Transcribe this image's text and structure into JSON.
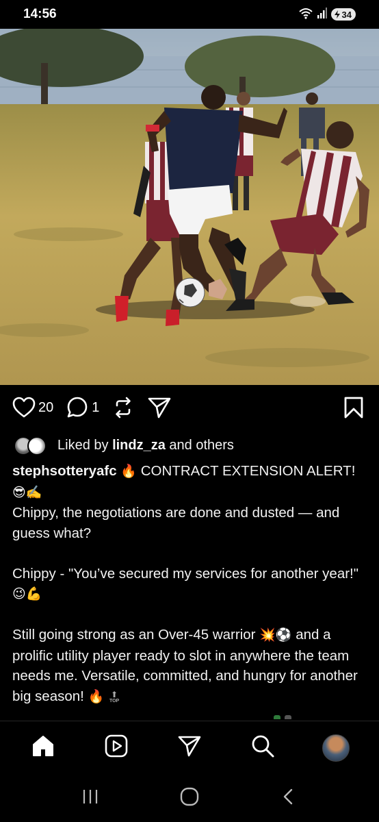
{
  "status_bar": {
    "time": "14:56",
    "battery": "34",
    "icons": [
      "wifi-icon",
      "signal-icon",
      "battery-icon"
    ]
  },
  "post": {
    "image": {
      "icon": "photo",
      "colors": {
        "grass": "#b9a25a",
        "sky": "#c7d4e0"
      }
    },
    "actions": {
      "likes": "20",
      "comments": "1",
      "icons": [
        "heart-icon",
        "comment-icon",
        "repost-icon",
        "share-icon",
        "bookmark-icon"
      ]
    },
    "liked_by": {
      "prefix": "Liked by",
      "user": "lindz_za",
      "suffix": "and others"
    },
    "caption": {
      "username": "stephsotteryafc",
      "line1_emoji": "🔥",
      "line1_text": "CONTRACT EXTENSION ALERT!",
      "line2_emoji": "😎✍️",
      "para1": "Chippy, the negotiations are done and dusted — and guess what?",
      "para2_text": "Chippy - \"You’ve secured my services for another year!\"",
      "para2_emoji": "😉💪",
      "para3_a": "Still going strong as an Over-45 warrior",
      "para3_emoji": "💥⚽",
      "para3_b": "and a prolific utility player ready to slot in anywhere the team needs me. Versatile, committed, and hungry for another big season!",
      "para3_end_emoji": "🔥",
      "top_badge": "TOP"
    }
  },
  "bottom_nav": {
    "items": [
      "home-icon",
      "reels-icon",
      "send-icon",
      "search-icon",
      "profile-avatar"
    ]
  },
  "system_nav": {
    "items": [
      "recents-icon",
      "home-button-icon",
      "back-icon"
    ]
  },
  "colors": {
    "background": "#000000",
    "text": "#f5f5f5",
    "divider": "#262626"
  }
}
